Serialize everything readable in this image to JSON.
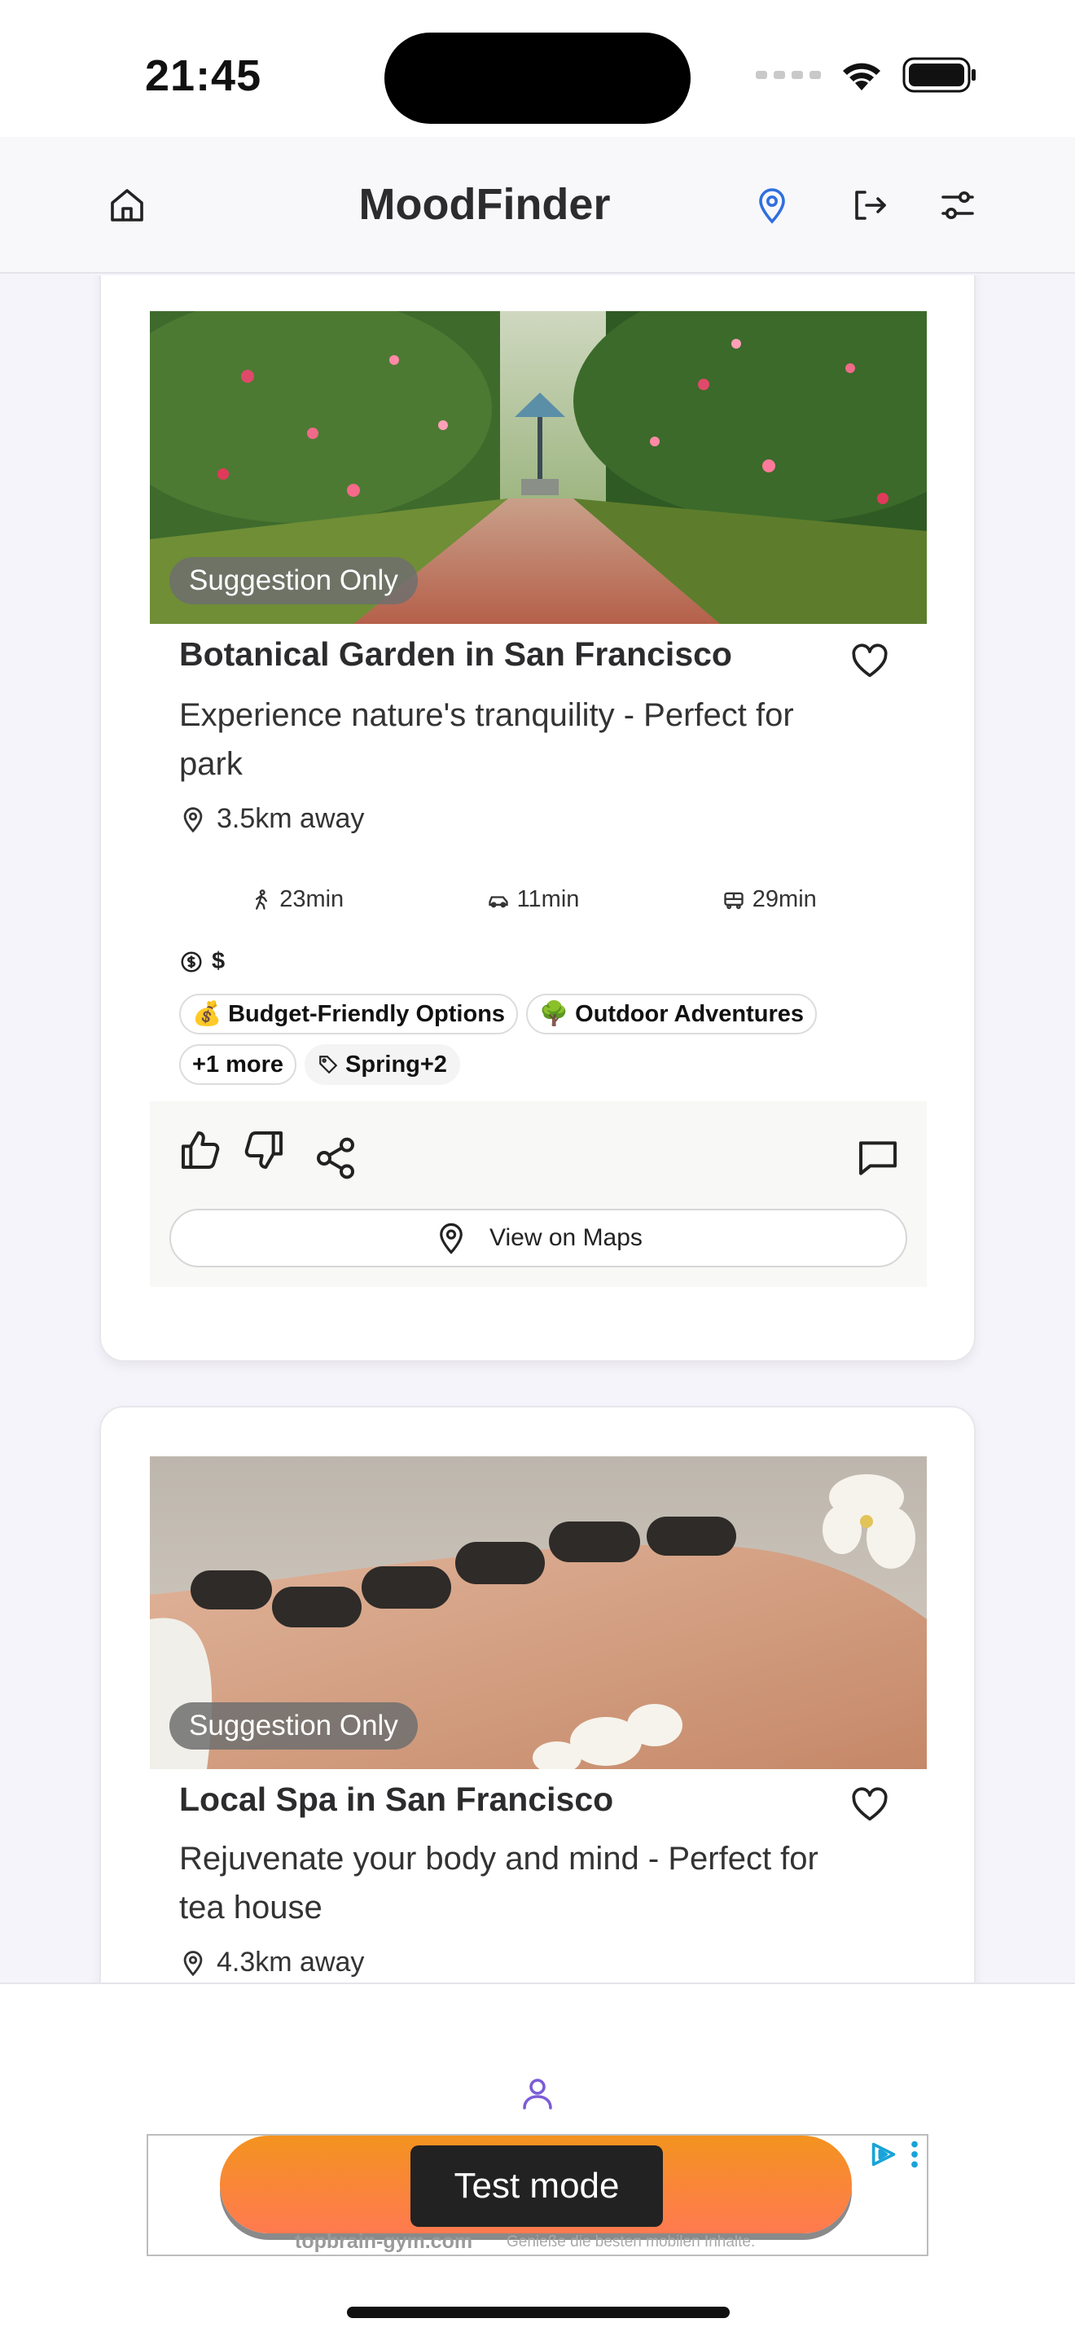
{
  "status_bar": {
    "time": "21:45"
  },
  "header": {
    "title": "MoodFinder"
  },
  "cards": [
    {
      "badge": "Suggestion Only",
      "title": "Botanical Garden in San Francisco",
      "subtitle": "Experience nature's tranquility - Perfect for park",
      "distance": "3.5km away",
      "travel": {
        "walk": "23min",
        "car": "11min",
        "transit": "29min"
      },
      "price": "$",
      "chips": [
        {
          "emoji": "💰",
          "label": "Budget-Friendly Options"
        },
        {
          "emoji": "🌳",
          "label": "Outdoor Adventures"
        },
        {
          "emoji": "",
          "label": "+1 more"
        }
      ],
      "season_tag": "Spring+2",
      "maps_label": "View on Maps"
    },
    {
      "badge": "Suggestion Only",
      "title": "Local Spa in San Francisco",
      "subtitle": "Rejuvenate your body and mind - Perfect for tea house",
      "distance": "4.3km away"
    }
  ],
  "ad": {
    "mode_label": "Test mode",
    "url": "topbrain-gym.com",
    "tagline": "Genieße die besten mobilen Inhalte."
  },
  "colors": {
    "accent_blue": "#2f6fde",
    "nav_purple": "#7b5cd6",
    "ad_orange": "#f3931f"
  }
}
